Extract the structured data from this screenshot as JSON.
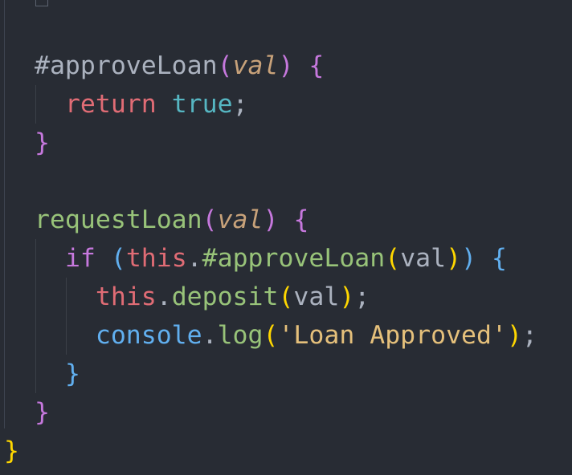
{
  "editor": {
    "theme_colors": {
      "background": "#282c34",
      "keyword": "#c678dd",
      "method": "#98c379",
      "param": "#c8a27a",
      "this": "#e06c75",
      "string": "#e5c07b",
      "console": "#61afef",
      "boolean": "#56b6c2",
      "text": "#abb2bf"
    },
    "lines": {
      "l1": {
        "hash_method": "#approveLoan",
        "open_paren": "(",
        "param": "val",
        "close_paren": ")",
        "space": " ",
        "brace": "{"
      },
      "l2": {
        "indent": "  ",
        "kw": "return",
        "space": " ",
        "value": "true",
        "semi": ";"
      },
      "l3": {
        "brace": "}"
      },
      "l5": {
        "method": "requestLoan",
        "open_paren": "(",
        "param": "val",
        "close_paren": ")",
        "space": " ",
        "brace": "{"
      },
      "l6": {
        "indent": "  ",
        "kw": "if",
        "space": " ",
        "open_paren": "(",
        "this": "this",
        "dot": ".",
        "hash_method": "#approveLoan",
        "inner_open": "(",
        "arg": "val",
        "inner_close": ")",
        "close_paren": ")",
        "space2": " ",
        "brace": "{"
      },
      "l7": {
        "indent": "    ",
        "this": "this",
        "dot": ".",
        "method": "deposit",
        "open_paren": "(",
        "arg": "val",
        "close_paren": ")",
        "semi": ";"
      },
      "l8": {
        "indent": "    ",
        "obj": "console",
        "dot": ".",
        "method": "log",
        "open_paren": "(",
        "string": "'Loan Approved'",
        "close_paren": ")",
        "semi": ";"
      },
      "l9": {
        "indent": "  ",
        "brace": "}"
      },
      "l10": {
        "brace": "}"
      },
      "l11": {
        "brace": "}"
      }
    }
  }
}
